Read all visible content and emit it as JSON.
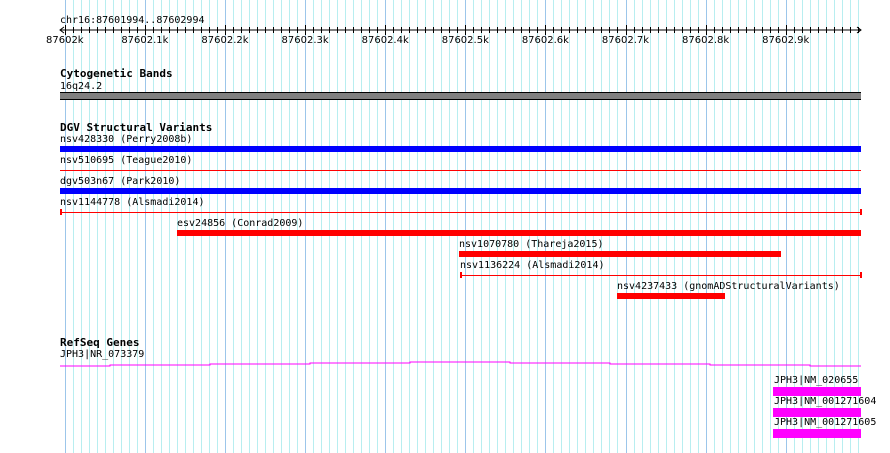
{
  "ruler": {
    "region": "chr16:87601994..87602994",
    "view_start": 87601994,
    "view_end": 87602994,
    "ticks": [
      {
        "pos": 87602000,
        "label": "87602k"
      },
      {
        "pos": 87602100,
        "label": "87602.1k"
      },
      {
        "pos": 87602200,
        "label": "87602.2k"
      },
      {
        "pos": 87602300,
        "label": "87602.3k"
      },
      {
        "pos": 87602400,
        "label": "87602.4k"
      },
      {
        "pos": 87602500,
        "label": "87602.5k"
      },
      {
        "pos": 87602600,
        "label": "87602.6k"
      },
      {
        "pos": 87602700,
        "label": "87602.7k"
      },
      {
        "pos": 87602800,
        "label": "87602.8k"
      },
      {
        "pos": 87602900,
        "label": "87602.9k"
      }
    ]
  },
  "tracks": {
    "cytobands": {
      "title": "Cytogenetic Bands",
      "band": "16q24.2",
      "color": "#808080"
    },
    "dgv": {
      "title": "DGV Structural Variants",
      "features": [
        {
          "label": "nsv428330 (Perry2008b)",
          "start": 87601994,
          "end": 87602994,
          "style": "thick",
          "color": "#0000ff"
        },
        {
          "label": "nsv510695 (Teague2010)",
          "start": 87601994,
          "end": 87602994,
          "style": "line",
          "color": "#ff0000"
        },
        {
          "label": "dgv503n67 (Park2010)",
          "start": 87601994,
          "end": 87602994,
          "style": "thick",
          "color": "#0000ff"
        },
        {
          "label": "nsv1144778 (Alsmadi2014)",
          "start": 87601994,
          "end": 87602994,
          "style": "capped",
          "color": "#ff0000"
        },
        {
          "label": "esv24856 (Conrad2009)",
          "start": 87602140,
          "end": 87602994,
          "style": "thick",
          "color": "#ff0000"
        },
        {
          "label": "nsv1070780 (Thareja2015)",
          "start": 87602492,
          "end": 87602894,
          "style": "thick",
          "color": "#ff0000"
        },
        {
          "label": "nsv1136224 (Alsmadi2014)",
          "start": 87602493,
          "end": 87602994,
          "style": "capped",
          "color": "#ff0000"
        },
        {
          "label": "nsv4237433 (gnomADStructuralVariants)",
          "start": 87602689,
          "end": 87602824,
          "style": "thick",
          "color": "#ff0000"
        }
      ]
    },
    "refseq": {
      "title": "RefSeq Genes",
      "color": "#ff00ff",
      "intron_gene": {
        "label": "JPH3|NR_073379"
      },
      "genes": [
        {
          "label": "JPH3|NM_020655",
          "start": 87602884,
          "end": 87602994
        },
        {
          "label": "JPH3|NM_001271604",
          "start": 87602884,
          "end": 87602994
        },
        {
          "label": "JPH3|NM_001271605",
          "start": 87602884,
          "end": 87602994
        }
      ]
    }
  }
}
